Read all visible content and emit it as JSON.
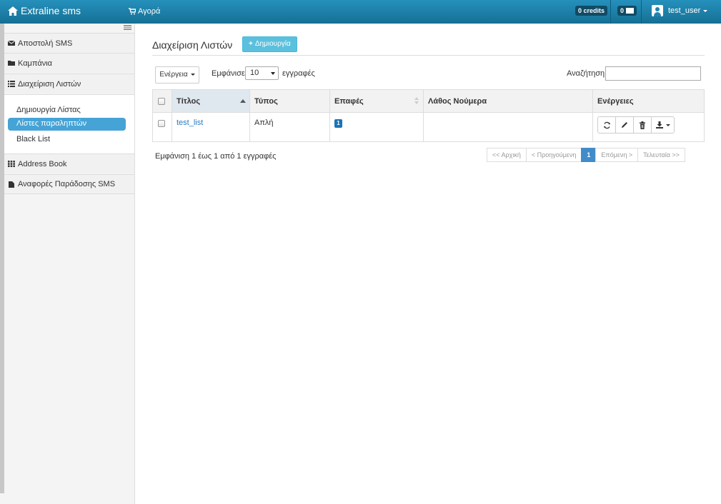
{
  "navbar": {
    "brand": "Extraline sms",
    "shop": "Αγορά",
    "credits": "0 credits",
    "messages": "0",
    "user": "test_user"
  },
  "sidebar": {
    "items": [
      {
        "label": "Αποστολή SMS",
        "icon": "envelope-icon"
      },
      {
        "label": "Καμπάνια",
        "icon": "folder-icon"
      },
      {
        "label": "Διαχείριση Λιστών",
        "icon": "list-icon"
      },
      {
        "label": "Address Book",
        "icon": "grid-icon"
      },
      {
        "label": "Αναφορές Παράδοσης SMS",
        "icon": "file-icon"
      }
    ],
    "submenu": [
      "Δημιουργία Λίστας",
      "Λίστες παραληπτών",
      "Black List"
    ]
  },
  "main": {
    "title": "Διαχείριση Λιστών",
    "create_label": "Δημιουργία",
    "actions_label": "Ενέργεια",
    "show_label": "Εμφάνισε",
    "page_size": "10",
    "records_label": "εγγραφές",
    "search_label": "Αναζήτηση",
    "search_value": ""
  },
  "table": {
    "headers": [
      "Τίτλος",
      "Τύπος",
      "Επαφές",
      "Λάθος Νούμερα",
      "Ενέργειες"
    ],
    "rows": [
      {
        "title": "test_list",
        "type": "Απλή",
        "contacts": "1",
        "wrong_numbers": ""
      }
    ]
  },
  "footer": {
    "info": "Εμφάνιση 1 έως 1 από 1 εγγραφές",
    "pager": [
      "<< Αρχική",
      "< Προηγούμενη",
      "1",
      "Επόμενη >",
      "Τελευταία >>"
    ]
  },
  "colors": {
    "navbar": "#1f86b2",
    "accent": "#45a3d6",
    "info_button": "#5bc0de"
  }
}
